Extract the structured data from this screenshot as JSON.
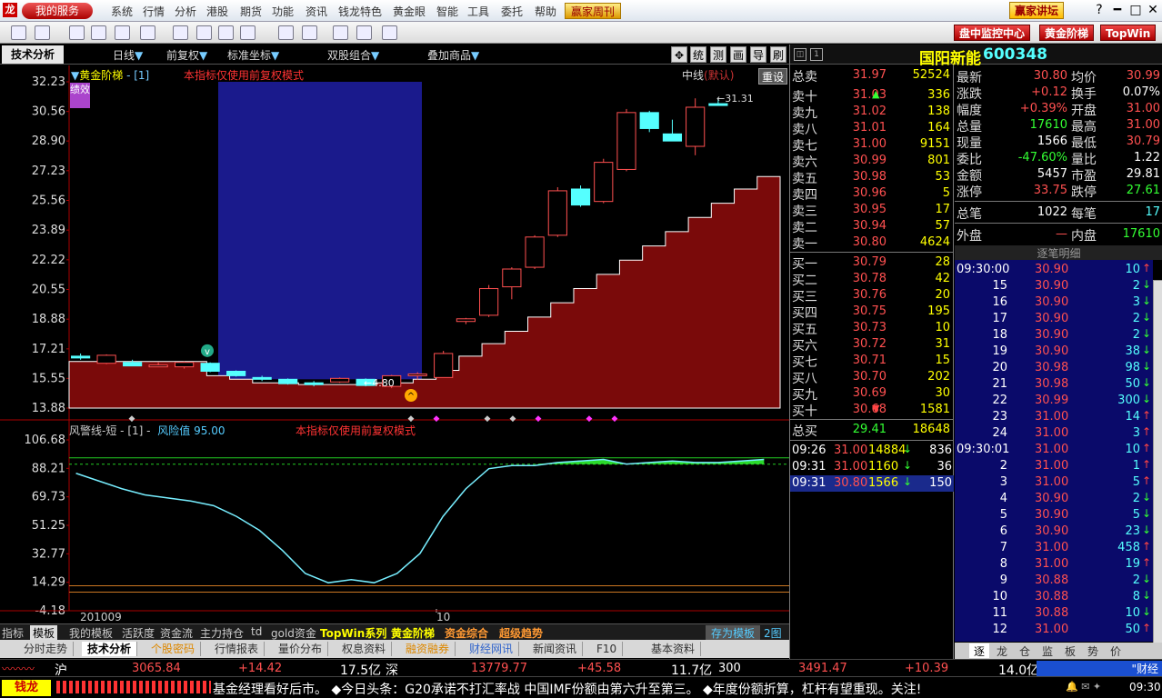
{
  "menubar": {
    "my_service": "我的服务",
    "items": [
      "系统",
      "行情",
      "分析",
      "港股",
      "期货",
      "功能",
      "资讯",
      "钱龙特色",
      "黄金眼",
      "智能",
      "工具",
      "委托",
      "帮助"
    ],
    "weekly": "赢家周刊",
    "lecture": "赢家讲坛",
    "win_buttons": [
      "?",
      "━",
      "□",
      "✕"
    ]
  },
  "toolbar": {
    "monitor": "盘中监控中心",
    "golden_ladder": "黄金阶梯",
    "topwin": "TopWin"
  },
  "tabstrip": {
    "tab": "技术分析",
    "dropdowns": [
      "日线",
      "前复权",
      "标准坐标",
      "双股组合",
      "叠加商品"
    ],
    "small_buttons": [
      "统",
      "测",
      "画",
      "导",
      "刷"
    ]
  },
  "main_chart": {
    "indicator_name": "黄金阶梯",
    "param": "[1]",
    "notice": "本指标仅使用前复权模式",
    "line_label": "中线",
    "default_label": "(默认)",
    "reset": "重设",
    "badge": "绩效",
    "y_ticks": [
      "32.23",
      "30.56",
      "28.90",
      "27.23",
      "25.56",
      "23.89",
      "22.22",
      "20.55",
      "18.88",
      "17.21",
      "15.55",
      "13.88"
    ],
    "high_label": "31.31",
    "low_label": "4.80"
  },
  "chart_data": {
    "type": "candlestick",
    "ylim": [
      13.88,
      32.23
    ],
    "candles": [
      [
        16.8,
        16.95,
        16.6,
        16.7
      ],
      [
        16.4,
        16.9,
        16.35,
        16.85
      ],
      [
        16.45,
        16.6,
        16.3,
        16.25
      ],
      [
        16.3,
        16.45,
        16.2,
        16.3
      ],
      [
        16.2,
        16.5,
        16.1,
        16.45
      ],
      [
        16.4,
        16.45,
        15.9,
        15.95
      ],
      [
        15.95,
        16.0,
        15.65,
        15.7
      ],
      [
        15.6,
        15.7,
        15.4,
        15.5
      ],
      [
        15.5,
        15.55,
        15.2,
        15.25
      ],
      [
        15.3,
        15.4,
        15.1,
        15.2
      ],
      [
        15.35,
        15.6,
        15.3,
        15.55
      ],
      [
        15.5,
        15.55,
        15.1,
        15.15
      ],
      [
        15.1,
        15.75,
        15.0,
        15.7
      ],
      [
        15.7,
        15.9,
        15.5,
        15.8
      ],
      [
        15.6,
        17.1,
        15.6,
        16.95
      ],
      [
        18.75,
        18.95,
        18.6,
        18.9
      ],
      [
        19.1,
        20.8,
        19.0,
        20.6
      ],
      [
        20.7,
        21.8,
        20.0,
        21.7
      ],
      [
        21.8,
        23.6,
        21.7,
        23.5
      ],
      [
        23.6,
        26.3,
        23.5,
        26.1
      ],
      [
        26.2,
        26.4,
        25.2,
        25.3
      ],
      [
        25.5,
        27.9,
        25.4,
        27.7
      ],
      [
        27.3,
        30.7,
        27.2,
        30.5
      ],
      [
        30.5,
        30.6,
        29.4,
        29.6
      ],
      [
        29.3,
        30.1,
        29.0,
        28.9
      ],
      [
        28.6,
        31.3,
        28.1,
        30.8
      ],
      [
        31.0,
        31.3,
        30.9,
        30.9
      ]
    ],
    "ladder": [
      16.5,
      16.5,
      16.5,
      16.5,
      16.5,
      16.5,
      15.7,
      15.5,
      15.3,
      15.3,
      15.2,
      15.2,
      15.2,
      15.3,
      15.3,
      15.5,
      16.0,
      16.8,
      17.5,
      18.2,
      19.0,
      19.8,
      20.6,
      21.4,
      22.2,
      23.0,
      23.8,
      24.6,
      25.4,
      26.2,
      26.9
    ],
    "indicator2": {
      "name": "风警线-短",
      "param": "[1]",
      "risk_label": "风险值",
      "risk_value": "95.00",
      "notice": "本指标仅使用前复权模式",
      "y_ticks": [
        "106.68",
        "88.21",
        "69.73",
        "51.25",
        "32.77",
        "14.29",
        "-4.18"
      ],
      "ylim": [
        -4.18,
        106.68
      ],
      "upper_line": 95.0,
      "lower_line": 12.0,
      "values": [
        85,
        80,
        75,
        71,
        69,
        67,
        64,
        57,
        48,
        35,
        20,
        14,
        16,
        14,
        20,
        33,
        57,
        75,
        88,
        90,
        90,
        92,
        93,
        94,
        91,
        92,
        93,
        92,
        92,
        93,
        94
      ]
    },
    "x_labels": [
      "201009",
      "10"
    ]
  },
  "quote": {
    "name": "国阳新能",
    "code": "600348",
    "sell_total_label": "总卖",
    "sell_total_price": "31.97",
    "sell_total_vol": "52524",
    "sells": [
      {
        "label": "卖十",
        "price": "31.03",
        "vol": "336"
      },
      {
        "label": "卖九",
        "price": "31.02",
        "vol": "138"
      },
      {
        "label": "卖八",
        "price": "31.01",
        "vol": "164"
      },
      {
        "label": "卖七",
        "price": "31.00",
        "vol": "9151"
      },
      {
        "label": "卖六",
        "price": "30.99",
        "vol": "801"
      },
      {
        "label": "卖五",
        "price": "30.98",
        "vol": "53"
      },
      {
        "label": "卖四",
        "price": "30.96",
        "vol": "5"
      },
      {
        "label": "卖三",
        "price": "30.95",
        "vol": "17"
      },
      {
        "label": "卖二",
        "price": "30.94",
        "vol": "57"
      },
      {
        "label": "卖一",
        "price": "30.80",
        "vol": "4624"
      }
    ],
    "buys": [
      {
        "label": "买一",
        "price": "30.79",
        "vol": "28"
      },
      {
        "label": "买二",
        "price": "30.78",
        "vol": "42"
      },
      {
        "label": "买三",
        "price": "30.76",
        "vol": "20"
      },
      {
        "label": "买四",
        "price": "30.75",
        "vol": "195"
      },
      {
        "label": "买五",
        "price": "30.73",
        "vol": "10"
      },
      {
        "label": "买六",
        "price": "30.72",
        "vol": "31"
      },
      {
        "label": "买七",
        "price": "30.71",
        "vol": "15"
      },
      {
        "label": "买八",
        "price": "30.70",
        "vol": "202"
      },
      {
        "label": "买九",
        "price": "30.69",
        "vol": "30"
      },
      {
        "label": "买十",
        "price": "30.68",
        "vol": "1581"
      }
    ],
    "buy_total_label": "总买",
    "buy_total_price": "29.41",
    "buy_total_vol": "18648",
    "trades": [
      {
        "time": "09:26",
        "price": "31.00",
        "vol": "14884",
        "n": "836"
      },
      {
        "time": "09:31",
        "price": "31.00",
        "vol": "1160",
        "n": "36"
      },
      {
        "time": "09:31",
        "price": "30.80",
        "vol": "1566",
        "n": "150"
      }
    ],
    "stats": [
      {
        "l1": "最新",
        "v1": "30.80",
        "c1": "red",
        "l2": "均价",
        "v2": "30.99",
        "c2": "red"
      },
      {
        "l1": "涨跌",
        "v1": "+0.12",
        "c1": "red",
        "l2": "换手",
        "v2": "0.07%",
        "c2": "white"
      },
      {
        "l1": "幅度",
        "v1": "+0.39%",
        "c1": "red",
        "l2": "开盘",
        "v2": "31.00",
        "c2": "red"
      },
      {
        "l1": "总量",
        "v1": "17610",
        "c1": "green",
        "l2": "最高",
        "v2": "31.00",
        "c2": "red"
      },
      {
        "l1": "现量",
        "v1": "1566",
        "c1": "white",
        "l2": "最低",
        "v2": "30.79",
        "c2": "red"
      },
      {
        "l1": "委比",
        "v1": "-47.60%",
        "c1": "green",
        "l2": "量比",
        "v2": "1.22",
        "c2": "white"
      },
      {
        "l1": "金额",
        "v1": "5457",
        "c1": "white",
        "l2": "市盈",
        "v2": "29.81",
        "c2": "white"
      },
      {
        "l1": "涨停",
        "v1": "33.75",
        "c1": "red",
        "l2": "跌停",
        "v2": "27.61",
        "c2": "green"
      }
    ],
    "total_count_label": "总笔",
    "total_count": "1022",
    "per_label": "每笔",
    "per": "17",
    "outer_label": "外盘",
    "outer": "—",
    "inner_label": "内盘",
    "inner": "17610",
    "detail_title": "逐笔明细",
    "details": [
      {
        "t": "09:30:00",
        "p": "30.90",
        "v": "10",
        "d": "up"
      },
      {
        "t": "15",
        "p": "30.90",
        "v": "2",
        "d": "down"
      },
      {
        "t": "16",
        "p": "30.90",
        "v": "3",
        "d": "down"
      },
      {
        "t": "17",
        "p": "30.90",
        "v": "2",
        "d": "down"
      },
      {
        "t": "18",
        "p": "30.90",
        "v": "2",
        "d": "down"
      },
      {
        "t": "19",
        "p": "30.90",
        "v": "38",
        "d": "down"
      },
      {
        "t": "20",
        "p": "30.98",
        "v": "98",
        "d": "down"
      },
      {
        "t": "21",
        "p": "30.98",
        "v": "50",
        "d": "down"
      },
      {
        "t": "22",
        "p": "30.99",
        "v": "300",
        "d": "down"
      },
      {
        "t": "23",
        "p": "31.00",
        "v": "14",
        "d": "up"
      },
      {
        "t": "24",
        "p": "31.00",
        "v": "3",
        "d": "up"
      },
      {
        "t": "09:30:01",
        "p": "31.00",
        "v": "10",
        "d": "up"
      },
      {
        "t": "2",
        "p": "31.00",
        "v": "1",
        "d": "up"
      },
      {
        "t": "3",
        "p": "31.00",
        "v": "5",
        "d": "up"
      },
      {
        "t": "4",
        "p": "30.90",
        "v": "2",
        "d": "down"
      },
      {
        "t": "5",
        "p": "30.90",
        "v": "5",
        "d": "down"
      },
      {
        "t": "6",
        "p": "30.90",
        "v": "23",
        "d": "down"
      },
      {
        "t": "7",
        "p": "31.00",
        "v": "458",
        "d": "up"
      },
      {
        "t": "8",
        "p": "31.00",
        "v": "19",
        "d": "up"
      },
      {
        "t": "9",
        "p": "30.88",
        "v": "2",
        "d": "down"
      },
      {
        "t": "10",
        "p": "30.88",
        "v": "8",
        "d": "down"
      },
      {
        "t": "11",
        "p": "30.88",
        "v": "10",
        "d": "down"
      },
      {
        "t": "12",
        "p": "31.00",
        "v": "50",
        "d": "up"
      }
    ],
    "side_tabs": [
      "逐",
      "龙",
      "仓",
      "监",
      "板",
      "势",
      "价"
    ]
  },
  "bottom": {
    "row1": [
      "指标",
      "模板",
      "我的模板",
      "活跃度",
      "资金流",
      "主力持仓",
      "td",
      "gold资金",
      "TopWin系列",
      "黄金阶梯",
      "资金综合",
      "超级趋势"
    ],
    "save_template": "存为模板",
    "two_chart": "2图",
    "row2": [
      "分时走势",
      "技术分析",
      "个股密码",
      "行情报表",
      "量价分布",
      "权息资料",
      "融资融券",
      "财经网讯",
      "新闻资讯",
      "F10",
      "基本资料"
    ]
  },
  "ticker": {
    "sh_label": "沪",
    "sh_idx": "3065.84",
    "sh_chg": "+14.42",
    "sh_amt": "17.5亿",
    "sz_label": "深",
    "sz_idx": "13779.77",
    "sz_chg": "+45.58",
    "sz_amt": "11.7亿",
    "hs_label": "300",
    "hs_idx": "3491.47",
    "hs_chg": "+10.39",
    "hs_amt": "14.0亿",
    "news": "基金经理看好后市。  ◆今日头条：G20承诺不打汇率战 中国IMF份额由第六升至第三。  ◆年度份额折算，杠杆有望重现。关注!",
    "right": "\"财经",
    "clock": "09:30"
  }
}
